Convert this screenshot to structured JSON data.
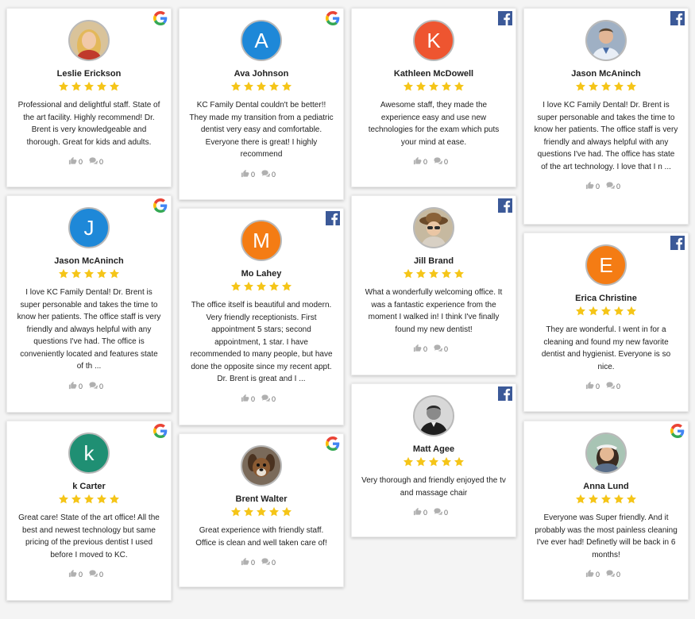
{
  "reviews": [
    {
      "name": "Leslie Erickson",
      "source": "google",
      "avatar_type": "photo",
      "avatar_letter": "",
      "avatar_color": "",
      "photo": "woman-blonde",
      "stars": 5,
      "text": "Professional and delightful staff. State of the art facility. Highly recommend! Dr. Brent is very knowledgeable and thorough. Great for kids and adults.",
      "likes": "0",
      "comments": "0"
    },
    {
      "name": "Ava Johnson",
      "source": "google",
      "avatar_type": "letter",
      "avatar_letter": "A",
      "avatar_color": "#1e88d8",
      "photo": "",
      "stars": 5,
      "text": "KC Family Dental couldn't be better!! They made my transition from a pediatric dentist very easy and comfortable. Everyone there is great! I highly recommend",
      "likes": "0",
      "comments": "0"
    },
    {
      "name": "Kathleen McDowell",
      "source": "facebook",
      "avatar_type": "letter",
      "avatar_letter": "K",
      "avatar_color": "#ee5530",
      "photo": "",
      "stars": 5,
      "text": "Awesome staff, they made the experience easy and use new technologies for the exam which puts your mind at ease.",
      "likes": "0",
      "comments": "0"
    },
    {
      "name": "Jason McAninch",
      "source": "facebook",
      "avatar_type": "photo",
      "avatar_letter": "",
      "avatar_color": "",
      "photo": "man-shirt",
      "stars": 5,
      "text": "I love KC Family Dental! Dr. Brent is super personable and takes the time to know her patients. The office staff is very friendly and always helpful with any questions I've had. The office has state of the art technology. I love that I n ...",
      "likes": "0",
      "comments": "0"
    },
    {
      "name": "Jason McAninch",
      "source": "google",
      "avatar_type": "letter",
      "avatar_letter": "J",
      "avatar_color": "#1e88d8",
      "photo": "",
      "stars": 5,
      "text": "I love KC Family Dental! Dr. Brent is super personable and takes the time to know her patients. The office staff is very friendly and always helpful with any questions I've had. The office is conveniently located and features state of th ...",
      "likes": "0",
      "comments": "0"
    },
    {
      "name": "Mo Lahey",
      "source": "facebook",
      "avatar_type": "letter",
      "avatar_letter": "M",
      "avatar_color": "#f47c14",
      "photo": "",
      "stars": 5,
      "text": "The office itself is beautiful and modern. Very friendly receptionists. First appointment 5 stars; second appointment, 1 star. I have recommended to many people, but have done the opposite since my recent appt. Dr. Brent is great and I ...",
      "likes": "0",
      "comments": "0"
    },
    {
      "name": "Jill Brand",
      "source": "facebook",
      "avatar_type": "photo",
      "avatar_letter": "",
      "avatar_color": "",
      "photo": "woman-hat",
      "stars": 5,
      "text": "What a wonderfully welcoming office. It was a fantastic experience from the moment I walked in! I think I've finally found my new dentist!",
      "likes": "0",
      "comments": "0"
    },
    {
      "name": "Erica Christine",
      "source": "facebook",
      "avatar_type": "letter",
      "avatar_letter": "E",
      "avatar_color": "#f47c14",
      "photo": "",
      "stars": 5,
      "text": "They are wonderful. I went in for a cleaning and found my new favorite dentist and hygienist. Everyone is so nice.",
      "likes": "0",
      "comments": "0"
    },
    {
      "name": "k Carter",
      "source": "google",
      "avatar_type": "letter",
      "avatar_letter": "k",
      "avatar_color": "#1f8f73",
      "photo": "",
      "stars": 5,
      "text": "Great care! State of the art office! All the best and newest technology but same pricing of the previous dentist I used before I moved to KC.",
      "likes": "0",
      "comments": "0"
    },
    {
      "name": "Brent Walter",
      "source": "google",
      "avatar_type": "photo",
      "avatar_letter": "",
      "avatar_color": "",
      "photo": "dog",
      "stars": 5,
      "text": "Great experience with friendly staff. Office is clean and well taken care of!",
      "likes": "0",
      "comments": "0"
    },
    {
      "name": "Matt Agee",
      "source": "facebook",
      "avatar_type": "photo",
      "avatar_letter": "",
      "avatar_color": "",
      "photo": "man-bw",
      "stars": 5,
      "text": "Very thorough and friendly enjoyed the tv and massage chair",
      "likes": "0",
      "comments": "0"
    },
    {
      "name": "Anna Lund",
      "source": "google",
      "avatar_type": "photo",
      "avatar_letter": "",
      "avatar_color": "",
      "photo": "woman-visor",
      "stars": 5,
      "text": "Everyone was Super friendly. And it probably was the most painless cleaning I've ever had! Definetly will be back in 6 months!",
      "likes": "0",
      "comments": "0"
    }
  ],
  "colors": {
    "star": "#f5c518",
    "facebook": "#3b5998",
    "meta_icon": "#b0b0b0"
  }
}
